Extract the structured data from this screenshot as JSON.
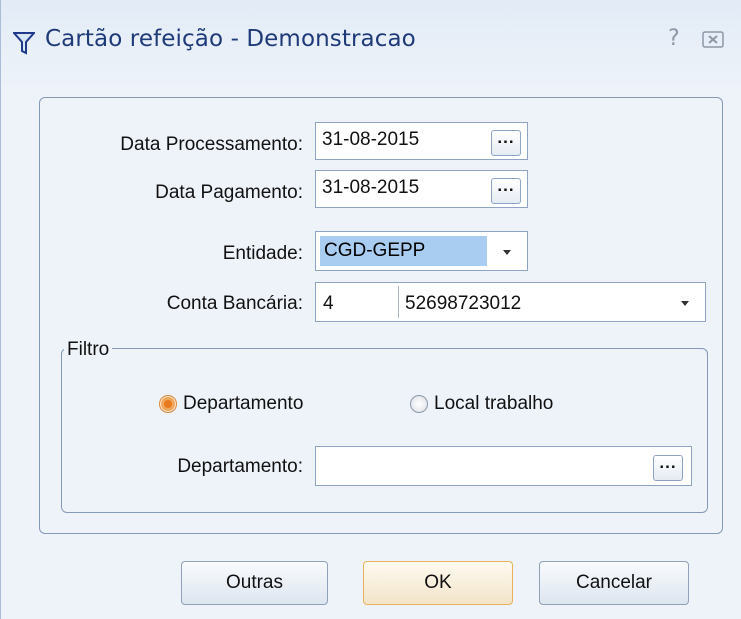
{
  "window": {
    "title": "Cartão refeição - Demonstracao",
    "help_glyph": "?",
    "app_icon": "funnel-icon",
    "close_icon": "close-icon"
  },
  "form": {
    "data_processamento": {
      "label": "Data Processamento:",
      "value": "31-08-2015",
      "button": "..."
    },
    "data_pagamento": {
      "label": "Data Pagamento:",
      "value": "31-08-2015",
      "button": "..."
    },
    "entidade": {
      "label": "Entidade:",
      "value": "CGD-GEPP"
    },
    "conta_bancaria": {
      "label": "Conta Bancária:",
      "code": "4",
      "account": "52698723012"
    }
  },
  "filtro": {
    "legend": "Filtro",
    "options": [
      {
        "label": "Departamento",
        "selected": true
      },
      {
        "label": "Local trabalho",
        "selected": false
      }
    ],
    "departamento": {
      "label": "Departamento:",
      "value": "",
      "button": "..."
    }
  },
  "buttons": {
    "outras": "Outras",
    "ok": "OK",
    "cancelar": "Cancelar"
  },
  "colors": {
    "title_text": "#1e3a78",
    "selection": "#a8cdf0",
    "radio_selected": "#e8791d",
    "default_button_border": "#e8b25b"
  }
}
